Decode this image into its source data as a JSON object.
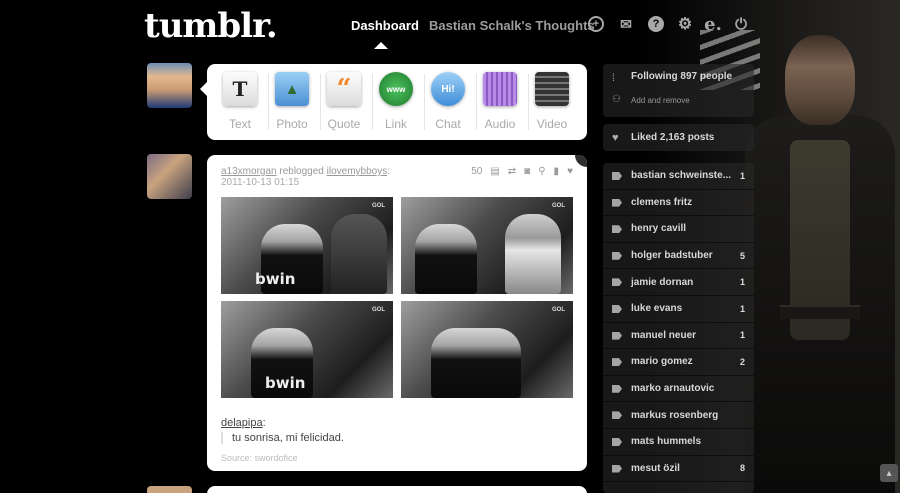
{
  "header": {
    "logo": "tumblr.",
    "tabs": [
      {
        "label": "Dashboard"
      },
      {
        "label": "Bastian Schalk's Thoughts"
      }
    ],
    "icons": [
      "plus-icon",
      "mail-icon",
      "help-icon",
      "gear-icon",
      "extension-icon",
      "power-icon"
    ]
  },
  "composer": {
    "types": [
      {
        "label": "Text",
        "glyph": "T",
        "color": "#222222"
      },
      {
        "label": "Photo",
        "glyph": "▲",
        "color": "#4a8fd4"
      },
      {
        "label": "Quote",
        "glyph": "“",
        "color": "#f28a2b"
      },
      {
        "label": "Link",
        "glyph": "www",
        "color": "#2a9e3e"
      },
      {
        "label": "Chat",
        "glyph": "Hi!",
        "color": "#3e8ed8"
      },
      {
        "label": "Audio",
        "glyph": "♫",
        "color": "#8a5bc2"
      },
      {
        "label": "Video",
        "glyph": "▦",
        "color": "#333333"
      }
    ]
  },
  "post": {
    "reblogger": "a13xmorgan",
    "action": " reblogged ",
    "source_user": "ilovemybboys",
    "colon": ":",
    "date": "2011-10-13 01:15",
    "notes": "50",
    "photos": [
      {
        "brand": "bwin",
        "tag": "GOL"
      },
      {
        "brand": "",
        "tag": "GOL"
      },
      {
        "brand": "bwin",
        "tag": "GOL"
      },
      {
        "brand": "",
        "tag": "GOL"
      }
    ],
    "caption_author": "delapipa",
    "caption_colon": ":",
    "caption_quote": "tu sonrisa, mi felicidad.",
    "source": "Source: swordofice"
  },
  "sidebar": {
    "following": "Following 897 people",
    "add_remove": "Add and remove",
    "liked": "Liked 2,163 posts",
    "tags": [
      {
        "name": "bastian schweinste...",
        "count": "1"
      },
      {
        "name": "clemens fritz",
        "count": ""
      },
      {
        "name": "henry cavill",
        "count": ""
      },
      {
        "name": "holger badstuber",
        "count": "5"
      },
      {
        "name": "jamie dornan",
        "count": "1"
      },
      {
        "name": "luke evans",
        "count": "1"
      },
      {
        "name": "manuel neuer",
        "count": "1"
      },
      {
        "name": "mario gomez",
        "count": "2"
      },
      {
        "name": "marko arnautovic",
        "count": ""
      },
      {
        "name": "markus rosenberg",
        "count": ""
      },
      {
        "name": "mats hummels",
        "count": ""
      },
      {
        "name": "mesut özil",
        "count": "8"
      }
    ]
  }
}
